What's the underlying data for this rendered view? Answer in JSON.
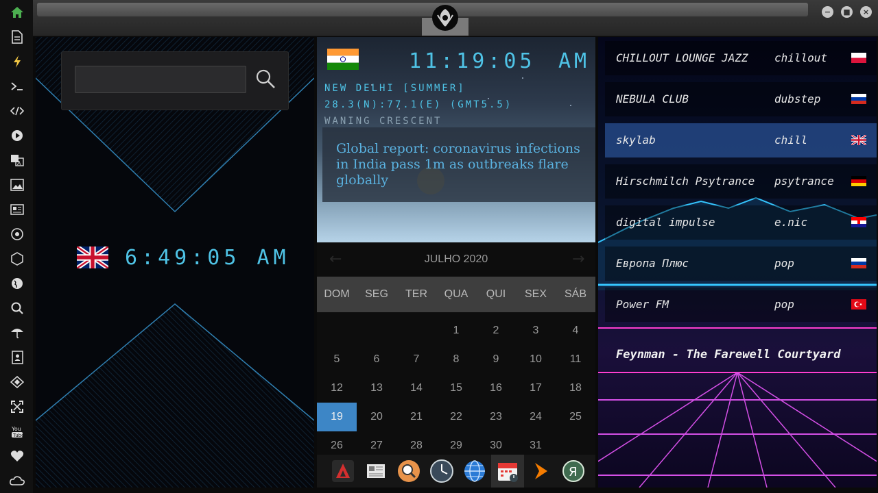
{
  "sidebar": {
    "icons": [
      "home-icon",
      "document-icon",
      "bolt-icon",
      "terminal-icon",
      "code-icon",
      "play-icon",
      "translate-icon",
      "image-icon",
      "news-icon",
      "rebel-icon",
      "hexagon-icon",
      "globe-icon",
      "search-icon",
      "umbrella-icon",
      "contacts-icon",
      "diamond-icon",
      "fullscreen-icon",
      "youtube-icon",
      "heart-icon",
      "cloud-icon"
    ]
  },
  "window": {
    "minimize": "−",
    "maximize": "■",
    "close": "×"
  },
  "search": {
    "value": "",
    "placeholder": ""
  },
  "uk_clock": {
    "time": "6:49:05  AM",
    "flag": "uk-flag"
  },
  "world_clock": {
    "time": "11:19:05",
    "ampm": "AM",
    "city": "NEW DELHI [SUMMER]",
    "coords": "28.3(N):77.1(E) (GMT5.5)",
    "moon": "WANING CRESCENT",
    "flag": "india-flag"
  },
  "news": {
    "headline": "Global report: coronavirus infections in India pass 1m as outbreaks flare globally"
  },
  "calendar": {
    "title": "JULHO 2020",
    "weekdays": [
      "DOM",
      "SEG",
      "TER",
      "QUA",
      "QUI",
      "SEX",
      "SÁB"
    ],
    "days": [
      [
        "",
        "",
        "",
        "1",
        "2",
        "3",
        "4"
      ],
      [
        "5",
        "6",
        "7",
        "8",
        "9",
        "10",
        "11"
      ],
      [
        "12",
        "13",
        "14",
        "15",
        "16",
        "17",
        "18"
      ],
      [
        "19",
        "20",
        "21",
        "22",
        "23",
        "24",
        "25"
      ],
      [
        "26",
        "27",
        "28",
        "29",
        "30",
        "31",
        ""
      ]
    ],
    "today": "19"
  },
  "dock": {
    "icons": [
      "arch-icon",
      "newspaper-icon",
      "search-app-icon",
      "clock-app-icon",
      "globe-app-icon",
      "calendar-app-icon",
      "play-app-icon",
      "yandex-icon"
    ],
    "active": "calendar-app-icon"
  },
  "radio": {
    "stations": [
      {
        "name": "CHILLOUT LOUNGE JAZZ",
        "genre": "chillout",
        "flag": "poland"
      },
      {
        "name": "NEBULA CLUB",
        "genre": "dubstep",
        "flag": "russia"
      },
      {
        "name": "skylab",
        "genre": "chill",
        "flag": "uk"
      },
      {
        "name": "Hirschmilch Psytrance",
        "genre": "psytrance",
        "flag": "germany"
      },
      {
        "name": "digital impulse",
        "genre": "e.nic",
        "flag": "croatia"
      },
      {
        "name": "Европа Плюс",
        "genre": "pop",
        "flag": "russia"
      },
      {
        "name": "Power FM",
        "genre": "pop",
        "flag": "turkey"
      }
    ],
    "selected": "skylab",
    "now_playing": "Feynman - The Farewell Courtyard"
  },
  "colors": {
    "accent": "#4fc3e6",
    "today": "#3d86c6",
    "selected_station": "#2a5296"
  }
}
